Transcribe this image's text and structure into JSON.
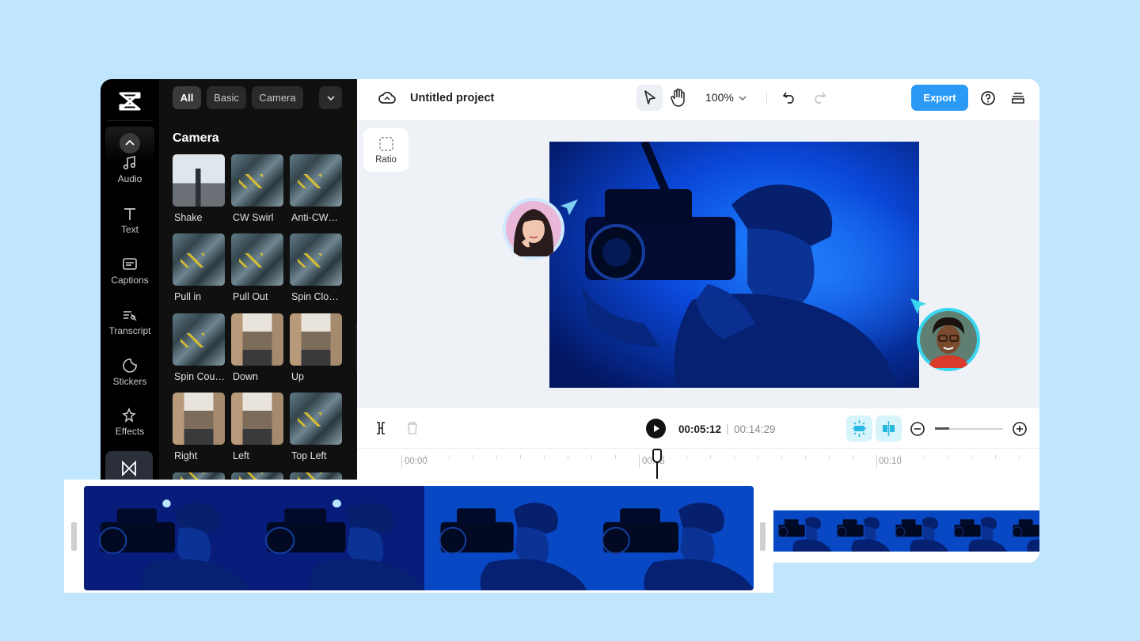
{
  "rail": {
    "items": [
      {
        "label": "Audio",
        "icon": "music-note-icon"
      },
      {
        "label": "Text",
        "icon": "text-t-icon"
      },
      {
        "label": "Captions",
        "icon": "captions-icon"
      },
      {
        "label": "Transcript",
        "icon": "transcript-icon"
      },
      {
        "label": "Stickers",
        "icon": "sticker-icon"
      },
      {
        "label": "Effects",
        "icon": "effects-sparkle-icon"
      }
    ],
    "active_icon": "transition-icon"
  },
  "panel": {
    "chips": [
      {
        "label": "All",
        "active": true
      },
      {
        "label": "Basic",
        "active": false
      },
      {
        "label": "Camera",
        "active": false
      }
    ],
    "title": "Camera",
    "items": [
      {
        "label": "Shake",
        "style": "skyline"
      },
      {
        "label": "CW Swirl",
        "style": "aerial"
      },
      {
        "label": "Anti-CW…",
        "style": "aerial"
      },
      {
        "label": "Pull in",
        "style": "aerial"
      },
      {
        "label": "Pull Out",
        "style": "aerial"
      },
      {
        "label": "Spin Clo…",
        "style": "aerial"
      },
      {
        "label": "Spin Cou…",
        "style": "aerial"
      },
      {
        "label": "Down",
        "style": "street"
      },
      {
        "label": "Up",
        "style": "street"
      },
      {
        "label": "Right",
        "style": "street"
      },
      {
        "label": "Left",
        "style": "street"
      },
      {
        "label": "Top Left",
        "style": "aerial"
      }
    ]
  },
  "topbar": {
    "project_title": "Untitled project",
    "zoom": "100%",
    "export_label": "Export"
  },
  "canvas": {
    "ratio_label": "Ratio"
  },
  "playback": {
    "current_time": "00:05:12",
    "separator": "|",
    "total_time": "00:14:29"
  },
  "ruler": {
    "labels": [
      "00:00",
      "00:05",
      "00:10"
    ]
  },
  "colors": {
    "page_bg": "#bfe6fd",
    "accent": "#2a9af6",
    "video_blue": "#0a3fd0",
    "collab_cyan": "#3ad6f0"
  }
}
